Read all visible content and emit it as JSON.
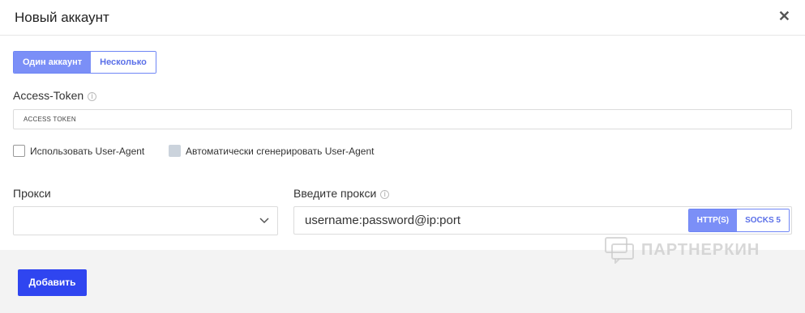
{
  "dialog": {
    "title": "Новый аккаунт",
    "close_icon": "close-icon"
  },
  "mode_tabs": [
    {
      "label": "Один аккаунт",
      "active": true
    },
    {
      "label": "Несколько",
      "active": false
    }
  ],
  "token": {
    "label": "Access-Token",
    "value": "ACCESS TOKEN"
  },
  "checkboxes": {
    "use_user_agent": "Использовать User-Agent",
    "auto_user_agent": "Автоматически сгенерировать User-Agent"
  },
  "proxy_select": {
    "label": "Прокси",
    "value": ""
  },
  "proxy_input": {
    "label": "Введите прокси",
    "placeholder": "username:password@ip:port",
    "protocols": [
      {
        "label": "HTTP(S)",
        "active": true
      },
      {
        "label": "SOCKS 5",
        "active": false
      }
    ]
  },
  "footer": {
    "add_label": "Добавить"
  },
  "watermark": {
    "text": "ПАРТНЕРКИН"
  },
  "colors": {
    "accent": "#7b8ff7",
    "primary_button": "#2f45f0"
  }
}
